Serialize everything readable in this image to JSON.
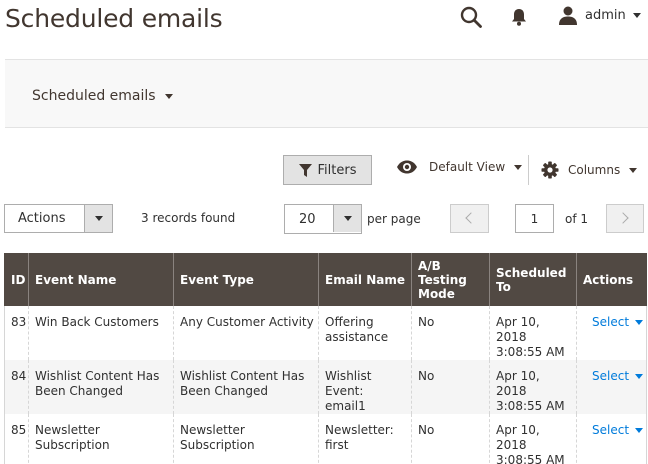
{
  "header": {
    "title": "Scheduled emails",
    "user_name": "admin"
  },
  "store_bar": {
    "label": "Scheduled emails"
  },
  "toolbar": {
    "filters_label": "Filters",
    "view_label": "Default View",
    "columns_label": "Columns"
  },
  "listing": {
    "actions_label": "Actions",
    "records_found": "3 records found",
    "per_page_value": "20",
    "per_page_label": "per page",
    "current_page": "1",
    "page_total": "of 1"
  },
  "table": {
    "columns": [
      "ID",
      "Event Name",
      "Event Type",
      "Email Name",
      "A/B Testing Mode",
      "Scheduled To",
      "Actions"
    ],
    "rows": [
      {
        "id": "83",
        "event_name": "Win Back Customers",
        "event_type": "Any Customer Activity",
        "email_name": "Offering assistance",
        "ab_mode": "No",
        "scheduled_date": "Apr 10, 2018",
        "scheduled_time": "3:08:55 AM",
        "action": "Select"
      },
      {
        "id": "84",
        "event_name": "Wishlist Content Has Been Changed",
        "event_type": "Wishlist Content Has Been Changed",
        "email_name": "Wishlist Event: email1",
        "ab_mode": "No",
        "scheduled_date": "Apr 10, 2018",
        "scheduled_time": "3:08:55 AM",
        "action": "Select"
      },
      {
        "id": "85",
        "event_name": "Newsletter Subscription",
        "event_type": "Newsletter Subscription",
        "email_name": "Newsletter: first",
        "ab_mode": "No",
        "scheduled_date": "Apr 10, 2018",
        "scheduled_time": "3:08:55 AM",
        "action": "Select"
      }
    ]
  },
  "icons": {
    "search": "search-icon",
    "notifications": "bell-icon",
    "user": "user-icon",
    "filter": "filter-icon",
    "view": "eye-icon",
    "columns": "gear-icon"
  },
  "colors": {
    "header_bg": "#514943",
    "link": "#007bdb",
    "title": "#41362f"
  }
}
